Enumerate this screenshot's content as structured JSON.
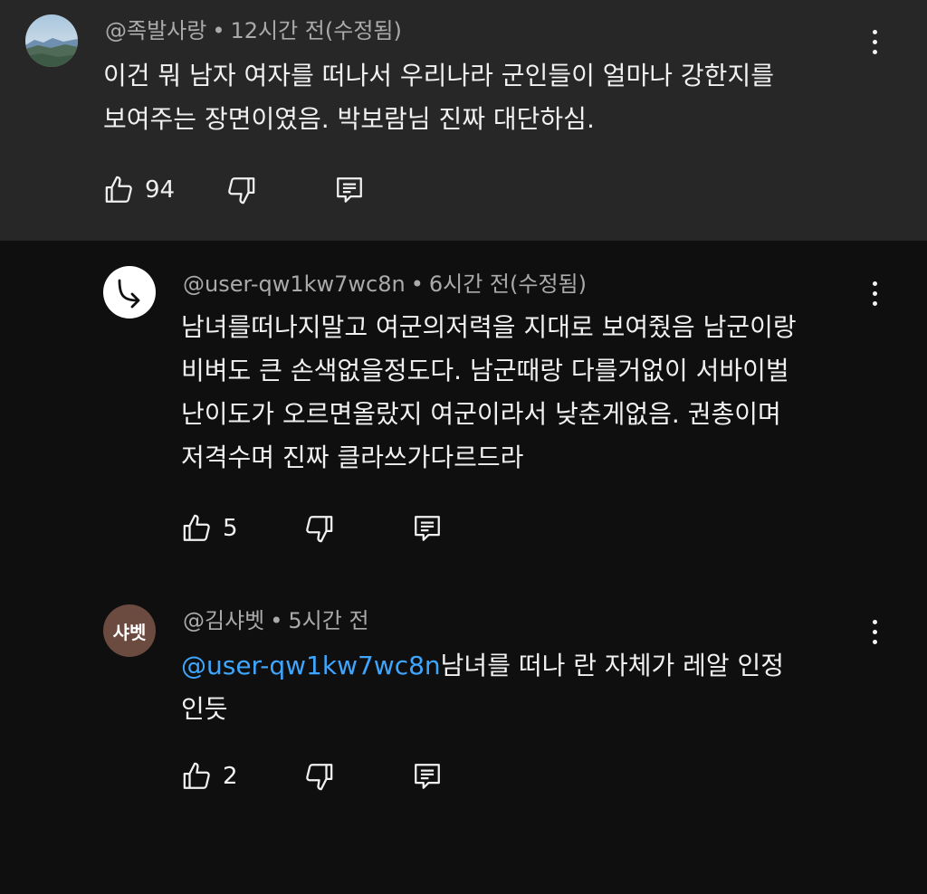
{
  "comments": [
    {
      "author": "@족발사랑",
      "time": "12시간 전(수정됨)",
      "text": "이건 뭐 남자 여자를 떠나서 우리나라 군인들이 얼마나 강한지를\n보여주는 장면이였음. 박보람님 진짜 대단하심.",
      "likes": "94",
      "avatar_icon": "landscape-avatar"
    },
    {
      "author": "@user-qw1kw7wc8n",
      "time": "6시간 전(수정됨)",
      "text": "남녀를떠나지말고 여군의저력을 지대로 보여줬음 남군이랑\n비벼도 큰 손색없을정도다. 남군때랑 다를거없이 서바이벌\n난이도가 오르면올랐지 여군이라서 낮춘게없음. 권총이며\n저격수며 진짜 클라쓰가다르드라",
      "likes": "5",
      "avatar_icon": "reply-arrow-icon"
    },
    {
      "author": "@김샤벳",
      "time": "5시간 전",
      "avatar_text": "샤벳",
      "mention": "@user-qw1kw7wc8n",
      "text": "남녀를 떠나 란 자체가 레알 인정\n인듯",
      "likes": "2"
    }
  ],
  "separator": "•",
  "colors": {
    "background": "#0f0f0f",
    "highlight_background": "#272727",
    "mention": "#3ea6ff",
    "meta_text": "#aaaaaa",
    "avatar_brown": "#6b4a3f"
  }
}
